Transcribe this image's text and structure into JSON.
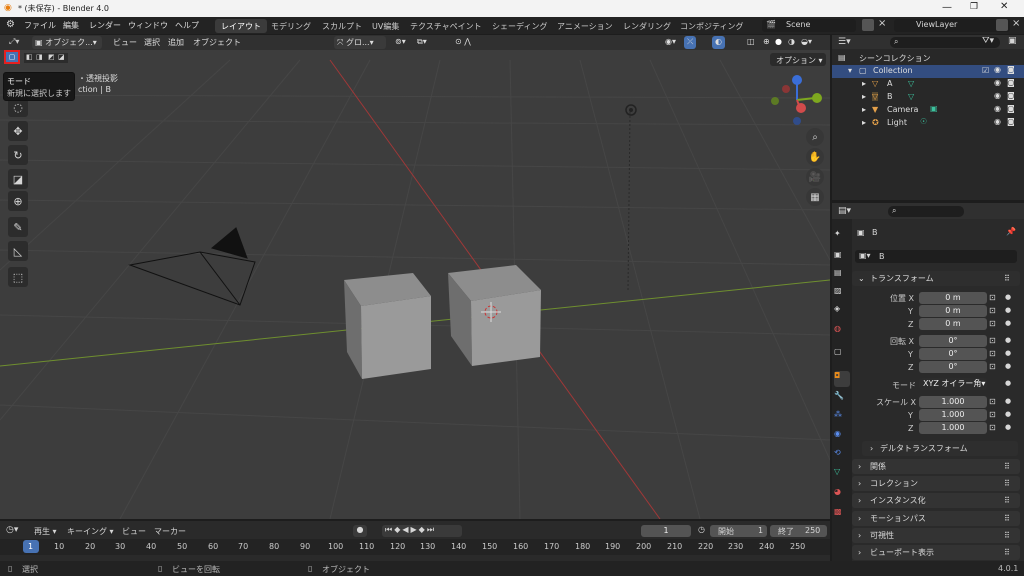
{
  "window": {
    "title": "* (未保存) - Blender 4.0"
  },
  "menu": [
    "ファイル",
    "編集",
    "レンダー",
    "ウィンドウ",
    "ヘルプ"
  ],
  "workspaces": [
    "レイアウト",
    "モデリング",
    "スカルプト",
    "UV編集",
    "テクスチャペイント",
    "シェーディング",
    "アニメーション",
    "レンダリング",
    "コンポジティング"
  ],
  "scene": "Scene",
  "viewlayer": "ViewLayer",
  "viewport_header": {
    "mode": "オブジェク...",
    "items": [
      "ビュー",
      "選択",
      "追加",
      "オブジェクト"
    ],
    "orientation": "グロ...",
    "options": "オプション"
  },
  "tooltip": {
    "title": "モード",
    "desc": "新規に選択します"
  },
  "overlay_text": {
    "line1": "・透視投影",
    "line2": "ction | B"
  },
  "outliner": {
    "root": "シーンコレクション",
    "collection": "Collection",
    "items": [
      "A",
      "B",
      "Camera",
      "Light"
    ]
  },
  "properties": {
    "object": "B",
    "name": "B",
    "transform": "トランスフォーム",
    "loc_label": "位置 X",
    "x": "X",
    "y": "Y",
    "z": "Z",
    "loc": [
      "0 m",
      "0 m",
      "0 m"
    ],
    "rot_label": "回転 X",
    "rot": [
      "0°",
      "0°",
      "0°"
    ],
    "mode_label": "モード",
    "mode": "XYZ オイラー角",
    "scale_label": "スケール X",
    "scale": [
      "1.000",
      "1.000",
      "1.000"
    ],
    "delta": "デルタトランスフォーム",
    "panels": [
      "関係",
      "コレクション",
      "インスタンス化",
      "モーションパス",
      "可視性",
      "ビューポート表示"
    ]
  },
  "timeline": {
    "play": "再生",
    "keying": "キーイング",
    "view": "ビュー",
    "marker": "マーカー",
    "frame": "1",
    "start_label": "開始",
    "start": "1",
    "end_label": "終了",
    "end": "250",
    "ticks": [
      "1",
      "10",
      "20",
      "30",
      "40",
      "50",
      "60",
      "70",
      "80",
      "90",
      "100",
      "110",
      "120",
      "130",
      "140",
      "150",
      "160",
      "170",
      "180",
      "190",
      "200",
      "210",
      "220",
      "230",
      "240",
      "250"
    ]
  },
  "status": {
    "select": "選択",
    "rotate": "ビューを回転",
    "object": "オブジェクト",
    "version": "4.0.1"
  }
}
